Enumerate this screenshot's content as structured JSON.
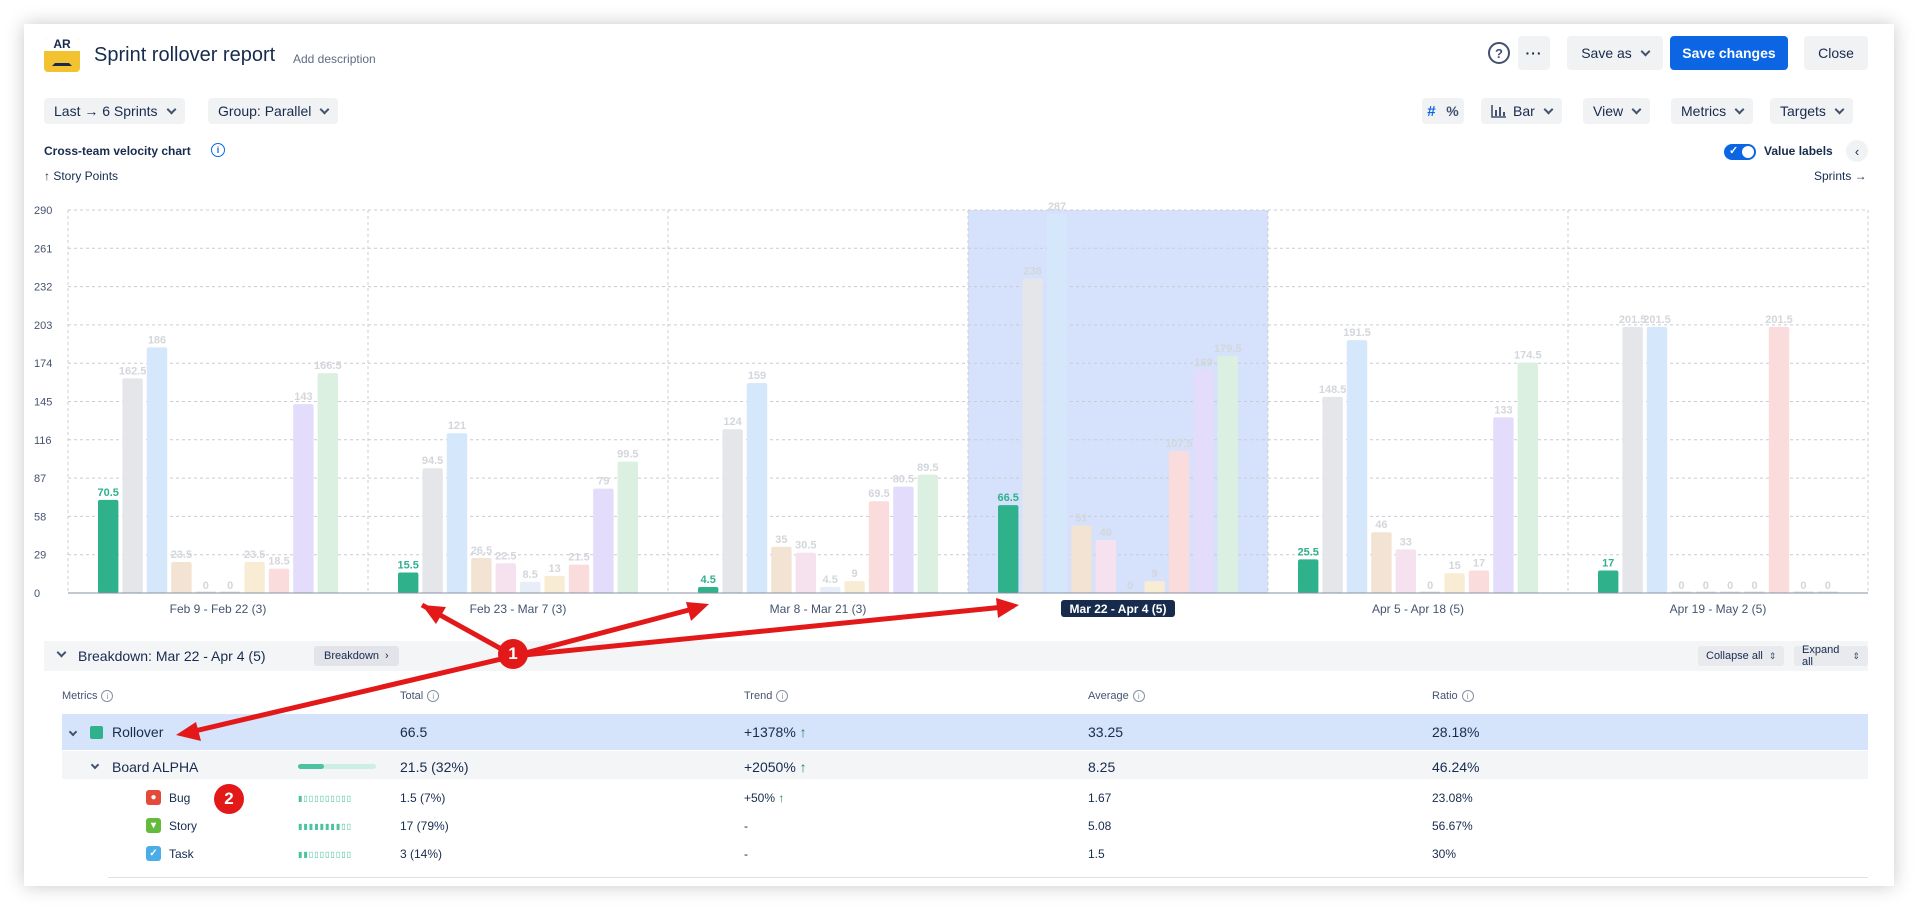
{
  "header": {
    "logo_text": "AR",
    "title": "Sprint rollover report",
    "add_description": "Add description",
    "help_icon": "?",
    "more_label": "···",
    "save_as": "Save as",
    "save_changes": "Save changes",
    "close": "Close"
  },
  "toolbar": {
    "period": "Last → 6 Sprints",
    "group": "Group: Parallel",
    "count_toggle": "#",
    "percent_toggle": "%",
    "chart_type": "Bar",
    "view": "View",
    "metrics": "Metrics",
    "targets": "Targets"
  },
  "chart_panel": {
    "title": "Cross-team velocity chart",
    "y_axis": "↑ Story Points",
    "x_axis": "Sprints →",
    "value_labels": "Value labels",
    "collapse_icon": "‹"
  },
  "chart_data": {
    "type": "bar",
    "ylabel": "Story Points",
    "xlabel": "Sprints",
    "ylim": [
      0,
      290
    ],
    "yticks": [
      0,
      29,
      58,
      87,
      116,
      145,
      174,
      203,
      232,
      261,
      290
    ],
    "grid": true,
    "value_labels": true,
    "categories": [
      "Feb 9 - Feb 22 (3)",
      "Feb 23 - Mar 7 (3)",
      "Mar 8 - Mar 21 (3)",
      "Mar 22 - Apr 4 (5)",
      "Apr 5 - Apr 18 (5)",
      "Apr 19 - May 2 (5)"
    ],
    "selected_category": 3,
    "series": [
      {
        "color": "#2fb18c",
        "values": [
          70.5,
          15.5,
          4.5,
          66.5,
          25.5,
          17
        ]
      },
      {
        "color": "#e4e6ea",
        "values": [
          162.5,
          94.5,
          124,
          238,
          148.5,
          201.5
        ]
      },
      {
        "color": "#d5e7fb",
        "values": [
          186,
          121,
          159,
          287,
          191.5,
          201.5
        ]
      },
      {
        "color": "#f2e3d3",
        "values": [
          23.5,
          26.5,
          35,
          51,
          46,
          0
        ]
      },
      {
        "color": "#f6e1ee",
        "values": [
          0,
          22.5,
          30.5,
          40,
          33,
          0
        ]
      },
      {
        "color": "#e7eef7",
        "values": [
          0,
          8.5,
          4.5,
          0,
          0,
          0
        ]
      },
      {
        "color": "#f9ecd4",
        "values": [
          23.5,
          13,
          9,
          9,
          15,
          0
        ]
      },
      {
        "color": "#fbdcdc",
        "values": [
          18.5,
          21.5,
          69.5,
          107.5,
          17,
          201.5
        ]
      },
      {
        "color": "#e3dcfb",
        "values": [
          143,
          79,
          80.5,
          169,
          133,
          0
        ]
      },
      {
        "color": "#dcf0e1",
        "values": [
          166.5,
          99.5,
          89.5,
          179.5,
          174.5,
          0
        ]
      }
    ]
  },
  "breakdown": {
    "title": "Breakdown: Mar 22 - Apr 4 (5)",
    "chip": "Breakdown",
    "collapse_all": "Collapse all",
    "expand_all": "Expand all",
    "columns": [
      "Metrics",
      "Total",
      "Trend",
      "Average",
      "Ratio"
    ],
    "rows": [
      {
        "name": "Rollover",
        "total": "66.5",
        "trend": "+1378%",
        "trend_arrow": "↑",
        "average": "33.25",
        "ratio": "28.18%"
      },
      {
        "name": "Board ALPHA",
        "total": "21.5 (32%)",
        "trend": "+2050%",
        "trend_arrow": "↑",
        "average": "8.25",
        "ratio": "46.24%"
      },
      {
        "name": "Bug",
        "total": "1.5 (7%)",
        "trend": "+50%",
        "trend_arrow": "↑",
        "average": "1.67",
        "ratio": "23.08%",
        "icon": "bug-icon",
        "icon_color": "#e5493a"
      },
      {
        "name": "Story",
        "total": "17 (79%)",
        "trend": "-",
        "trend_arrow": "",
        "average": "5.08",
        "ratio": "56.67%",
        "icon": "story-icon",
        "icon_color": "#63ba3c"
      },
      {
        "name": "Task",
        "total": "3 (14%)",
        "trend": "-",
        "trend_arrow": "",
        "average": "1.5",
        "ratio": "30%",
        "icon": "task-icon",
        "icon_color": "#4bade8"
      }
    ]
  },
  "annotations": {
    "badge_1": "1",
    "badge_2": "2",
    "arrow_color": "#e31818"
  }
}
